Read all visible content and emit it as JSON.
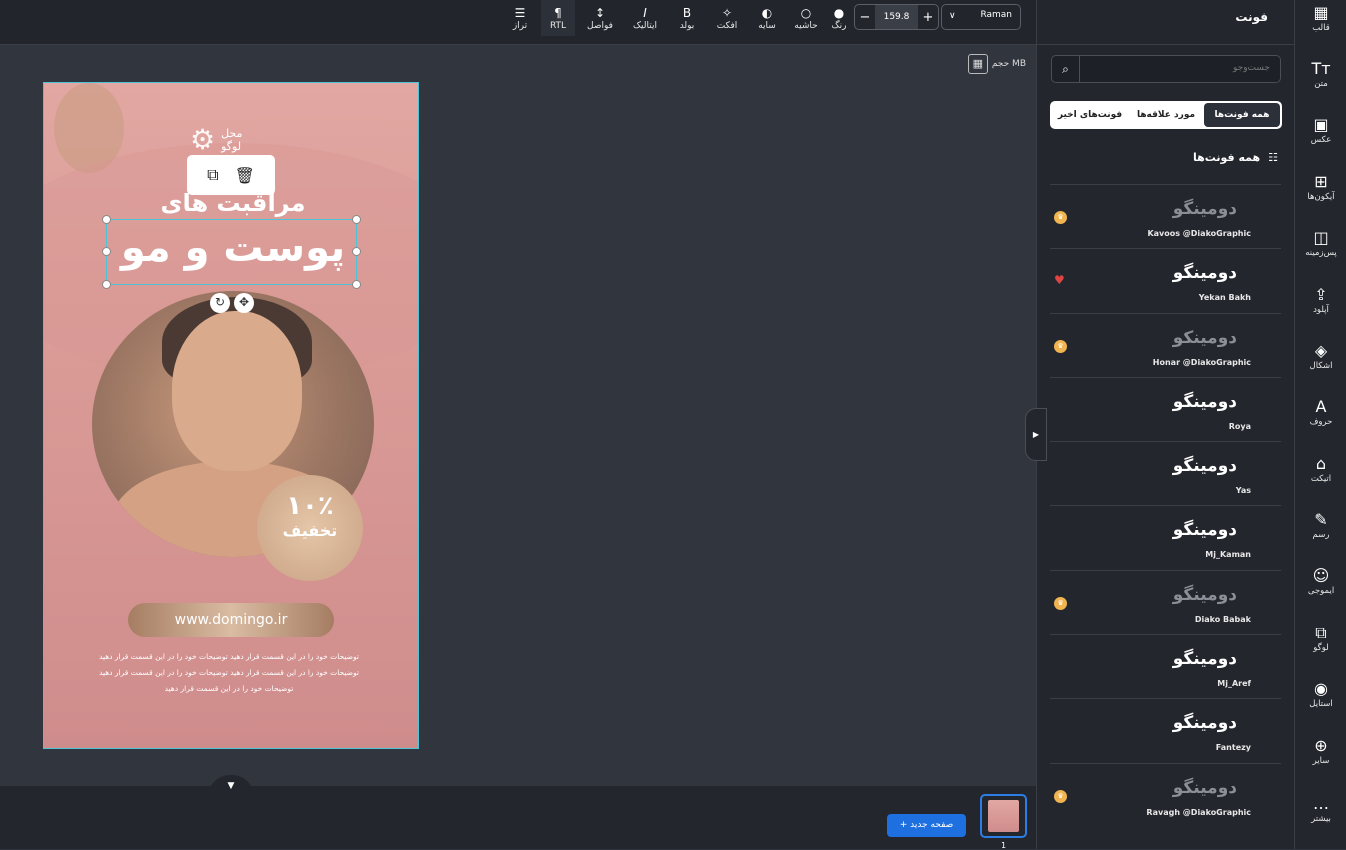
{
  "toolbar": {
    "font_name": "Raman",
    "font_size": "159.8",
    "minus": "−",
    "plus": "+",
    "items": [
      {
        "icon": "☰",
        "label": "تراز"
      },
      {
        "icon": "¶",
        "label": "RTL"
      },
      {
        "icon": "↕",
        "label": "فواصل"
      },
      {
        "icon": "I",
        "label": "ایتالیک"
      },
      {
        "icon": "B",
        "label": "بولد"
      },
      {
        "icon": "✧",
        "label": "افکت"
      },
      {
        "icon": "◐",
        "label": "سایه"
      },
      {
        "icon": "○",
        "label": "حاشیه"
      },
      {
        "icon": "●",
        "label": "رنگ"
      }
    ]
  },
  "canvas": {
    "file_size_label": "حجم MB",
    "logo_line1": "محل",
    "logo_line2": "لوگو",
    "title_line1": "مراقبت های",
    "title_line2": "پوست و مو",
    "discount_pct": "۱۰٪",
    "discount_label": "تخفیف",
    "url": "www.domingo.ir",
    "desc_lines": [
      "توضیحات خود را در این قسمت قرار دهید توضیحات خود را در این قسمت قرار دهید",
      "توضیحات خود را در این قسمت قرار دهید توضیحات خود را در این قسمت قرار دهید",
      "توضیحات خود را در این قسمت قرار دهید"
    ]
  },
  "bottom": {
    "new_page": "+ صفحه جدید",
    "page_number": "1"
  },
  "panel": {
    "title": "فونت",
    "search_placeholder": "جست‌وجو",
    "tabs": [
      "همه فونت‌ها",
      "مورد علاقه‌ها",
      "فونت‌های اخیر"
    ],
    "section_title": "همه فونت‌ها",
    "fonts": [
      {
        "preview": "دومینگو",
        "name": "Kavoos @DiakoGraphic",
        "badge": "premium"
      },
      {
        "preview": "دومینگو",
        "name": "Yekan Bakh",
        "badge": "favorite"
      },
      {
        "preview": "دومینکو",
        "name": "Honar @DiakoGraphic",
        "badge": "premium"
      },
      {
        "preview": "دومینگو",
        "name": "Roya",
        "badge": ""
      },
      {
        "preview": "دومینگو",
        "name": "Yas",
        "badge": ""
      },
      {
        "preview": "دومینگو",
        "name": "Mj_Kaman",
        "badge": ""
      },
      {
        "preview": "دومینگو",
        "name": "Diako Babak",
        "badge": "premium"
      },
      {
        "preview": "دومینگو",
        "name": "Mj_Aref",
        "badge": ""
      },
      {
        "preview": "دومینگو",
        "name": "Fantezy",
        "badge": ""
      },
      {
        "preview": "دومینگو",
        "name": "Ravagh @DiakoGraphic",
        "badge": "premium"
      }
    ]
  },
  "sidebar": [
    {
      "icon": "▦",
      "label": "قالب"
    },
    {
      "icon": "Tт",
      "label": "متن"
    },
    {
      "icon": "▣",
      "label": "عکس"
    },
    {
      "icon": "⊞",
      "label": "آیکون‌ها"
    },
    {
      "icon": "◫",
      "label": "پس‌زمینه"
    },
    {
      "icon": "⇪",
      "label": "آپلود"
    },
    {
      "icon": "◈",
      "label": "اشکال"
    },
    {
      "icon": "A",
      "label": "حروف"
    },
    {
      "icon": "⌂",
      "label": "اتیکت"
    },
    {
      "icon": "✎",
      "label": "رسم"
    },
    {
      "icon": "☺",
      "label": "ایموجی"
    },
    {
      "icon": "⧉",
      "label": "لوگو"
    },
    {
      "icon": "◉",
      "label": "استایل"
    },
    {
      "icon": "⊕",
      "label": "سایر"
    },
    {
      "icon": "…",
      "label": "بیشتر"
    }
  ]
}
